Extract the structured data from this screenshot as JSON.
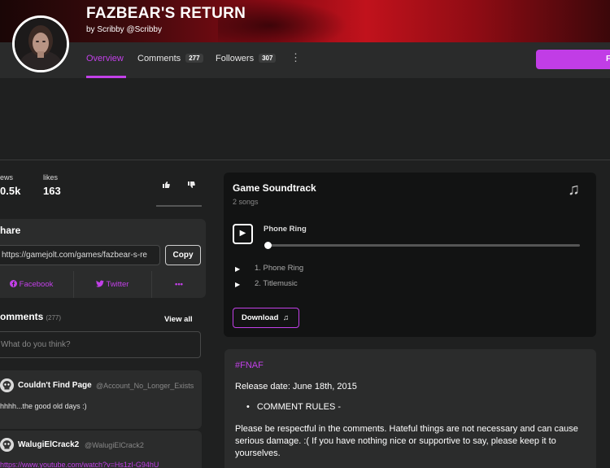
{
  "header": {
    "title": "FAZBEAR'S RETURN",
    "author": "by Scribby @Scribby"
  },
  "nav": {
    "tabs": [
      {
        "label": "Overview"
      },
      {
        "label": "Comments",
        "count": "277"
      },
      {
        "label": "Followers",
        "count": "307"
      }
    ],
    "more_icon": "⋮",
    "follow_label": "F"
  },
  "stats": {
    "views_label": "ews",
    "views_value": "0.5k",
    "likes_label": "likes",
    "likes_value": "163",
    "like_icon": "thumbs-up-icon",
    "dislike_icon": "thumbs-down-icon"
  },
  "share": {
    "title": "hare",
    "url": "https://gamejolt.com/games/fazbear-s-re",
    "copy_label": "Copy",
    "facebook_label": "Facebook",
    "twitter_label": "Twitter",
    "more_label": "•••"
  },
  "comments": {
    "title": "omments",
    "count": "(277)",
    "view_all": "View all",
    "input_placeholder": "What do you think?",
    "items": [
      {
        "name": "Couldn't Find Page",
        "handle": "@Account_No_Longer_Exists",
        "text": "hhhh...the good old days :)"
      },
      {
        "name": "WalugiElCrack2",
        "handle": "@WalugiElCrack2",
        "text": "https://www.youtube.com/watch?v=Hs1zI-G94hU"
      }
    ]
  },
  "soundtrack": {
    "title": "Game Soundtrack",
    "subtitle": "2 songs",
    "current_track": "Phone Ring",
    "progress": 0.0,
    "tracks": [
      "1. Phone Ring",
      "2. Titlemusic"
    ],
    "download_label": "Download"
  },
  "description": {
    "hashtag": "#FNAF",
    "release": "Release date: June 18th, 2015",
    "bullet": "COMMENT RULES -",
    "rules": "Please be respectful in the comments. Hateful things are not necessary and can cause serious damage. :( If you have nothing nice or supportive to say, please keep it to yourselves."
  },
  "colors": {
    "accent": "#c240e8",
    "banner_red": "#c1121c",
    "background": "#1f2020",
    "card": "#2b2c2c"
  }
}
